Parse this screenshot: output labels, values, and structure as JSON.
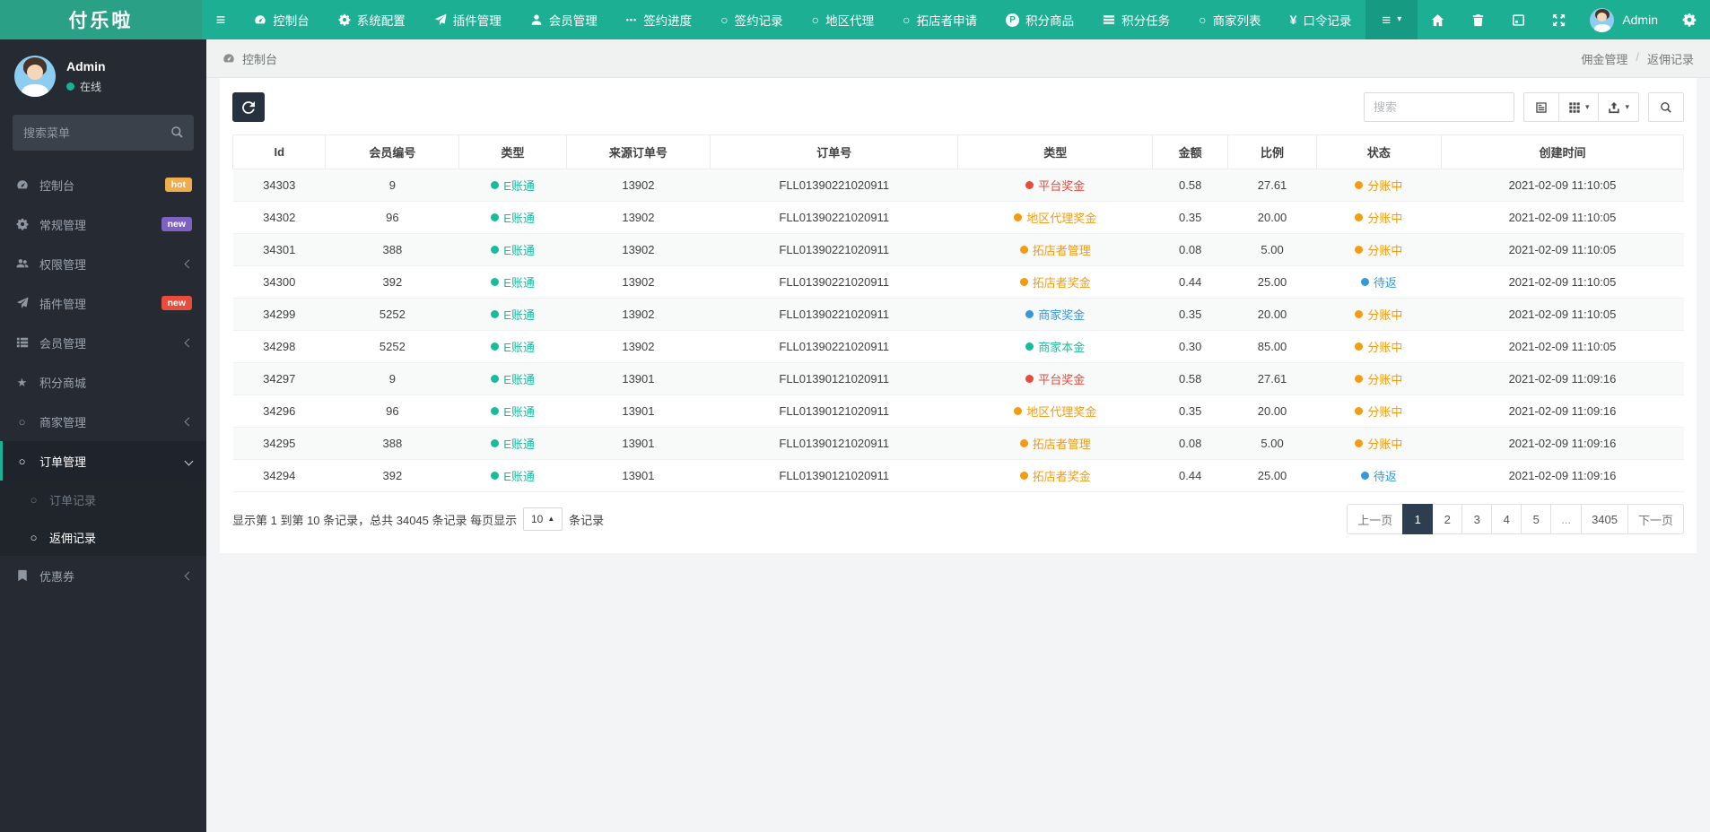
{
  "brand": "付乐啦",
  "navbar": {
    "menu": [
      {
        "key": "dashboard",
        "label": "控制台",
        "icon": "gauge-icon"
      },
      {
        "key": "system-config",
        "label": "系统配置",
        "icon": "gear-icon"
      },
      {
        "key": "plugin-manage",
        "label": "插件管理",
        "icon": "paper-plane-icon"
      },
      {
        "key": "member-manage",
        "label": "会员管理",
        "icon": "user-icon"
      },
      {
        "key": "sign-progress",
        "label": "签约进度",
        "icon": "ellipsis-icon"
      },
      {
        "key": "sign-records",
        "label": "签约记录",
        "icon": "circle-icon"
      },
      {
        "key": "region-agent",
        "label": "地区代理",
        "icon": "circle-icon"
      },
      {
        "key": "shop-applicant",
        "label": "拓店者申请",
        "icon": "circle-icon"
      },
      {
        "key": "points-goods",
        "label": "积分商品",
        "icon": "p-circle-icon"
      },
      {
        "key": "points-task",
        "label": "积分任务",
        "icon": "bars-icon"
      },
      {
        "key": "merchant-list",
        "label": "商家列表",
        "icon": "circle-icon"
      },
      {
        "key": "password-records",
        "label": "口令记录",
        "icon": "yen-icon"
      }
    ],
    "username": "Admin"
  },
  "sidebar": {
    "username": "Admin",
    "status": "在线",
    "search_placeholder": "搜索菜单",
    "menu": [
      {
        "key": "dashboard",
        "label": "控制台",
        "icon": "gauge-icon",
        "badge": "hot",
        "badge_color": "#f0ad4e"
      },
      {
        "key": "general-manage",
        "label": "常规管理",
        "icon": "cogs-icon",
        "badge": "new",
        "badge_color": "#7d62c3"
      },
      {
        "key": "permission-manage",
        "label": "权限管理",
        "icon": "users-icon",
        "chevron": "left"
      },
      {
        "key": "plugin-manage",
        "label": "插件管理",
        "icon": "paper-plane-icon",
        "badge": "new",
        "badge_color": "#e74c3c"
      },
      {
        "key": "member-manage",
        "label": "会员管理",
        "icon": "list-icon",
        "chevron": "left"
      },
      {
        "key": "points-mall",
        "label": "积分商城",
        "icon": "star-icon"
      },
      {
        "key": "merchant-manage",
        "label": "商家管理",
        "icon": "circle-icon",
        "chevron": "left"
      },
      {
        "key": "order-manage",
        "label": "订单管理",
        "icon": "circle-icon",
        "chevron": "down",
        "active": true
      },
      {
        "key": "order-records",
        "label": "订单记录",
        "icon": "circle-icon",
        "sub": true
      },
      {
        "key": "rebate-records",
        "label": "返佣记录",
        "icon": "circle-icon",
        "sub": true,
        "active": true
      },
      {
        "key": "coupon",
        "label": "优惠券",
        "icon": "bookmark-icon",
        "chevron": "left"
      }
    ]
  },
  "breadcrumb": {
    "left": "控制台",
    "right_parent": "佣金管理",
    "divider": "/",
    "right_current": "返佣记录"
  },
  "toolbar": {
    "search_placeholder": "搜索"
  },
  "table": {
    "headers": [
      "Id",
      "会员编号",
      "类型",
      "来源订单号",
      "订单号",
      "类型",
      "金额",
      "比例",
      "状态",
      "创建时间"
    ],
    "rows": [
      {
        "id": "34303",
        "member": "9",
        "type1": "E账通",
        "type1_color": "#18bc9c",
        "source": "13902",
        "order": "FLL01390221020911",
        "type2": "平台奖金",
        "type2_color": "#e74c3c",
        "amount": "0.58",
        "ratio": "27.61",
        "status": "分账中",
        "status_color": "#f39c12",
        "created": "2021-02-09 11:10:05"
      },
      {
        "id": "34302",
        "member": "96",
        "type1": "E账通",
        "type1_color": "#18bc9c",
        "source": "13902",
        "order": "FLL01390221020911",
        "type2": "地区代理奖金",
        "type2_color": "#f39c12",
        "amount": "0.35",
        "ratio": "20.00",
        "status": "分账中",
        "status_color": "#f39c12",
        "created": "2021-02-09 11:10:05"
      },
      {
        "id": "34301",
        "member": "388",
        "type1": "E账通",
        "type1_color": "#18bc9c",
        "source": "13902",
        "order": "FLL01390221020911",
        "type2": "拓店者管理",
        "type2_color": "#f39c12",
        "amount": "0.08",
        "ratio": "5.00",
        "status": "分账中",
        "status_color": "#f39c12",
        "created": "2021-02-09 11:10:05"
      },
      {
        "id": "34300",
        "member": "392",
        "type1": "E账通",
        "type1_color": "#18bc9c",
        "source": "13902",
        "order": "FLL01390221020911",
        "type2": "拓店者奖金",
        "type2_color": "#f39c12",
        "amount": "0.44",
        "ratio": "25.00",
        "status": "待返",
        "status_color": "#3498db",
        "created": "2021-02-09 11:10:05"
      },
      {
        "id": "34299",
        "member": "5252",
        "type1": "E账通",
        "type1_color": "#18bc9c",
        "source": "13902",
        "order": "FLL01390221020911",
        "type2": "商家奖金",
        "type2_color": "#3498db",
        "amount": "0.35",
        "ratio": "20.00",
        "status": "分账中",
        "status_color": "#f39c12",
        "created": "2021-02-09 11:10:05"
      },
      {
        "id": "34298",
        "member": "5252",
        "type1": "E账通",
        "type1_color": "#18bc9c",
        "source": "13902",
        "order": "FLL01390221020911",
        "type2": "商家本金",
        "type2_color": "#18bc9c",
        "amount": "0.30",
        "ratio": "85.00",
        "status": "分账中",
        "status_color": "#f39c12",
        "created": "2021-02-09 11:10:05"
      },
      {
        "id": "34297",
        "member": "9",
        "type1": "E账通",
        "type1_color": "#18bc9c",
        "source": "13901",
        "order": "FLL01390121020911",
        "type2": "平台奖金",
        "type2_color": "#e74c3c",
        "amount": "0.58",
        "ratio": "27.61",
        "status": "分账中",
        "status_color": "#f39c12",
        "created": "2021-02-09 11:09:16"
      },
      {
        "id": "34296",
        "member": "96",
        "type1": "E账通",
        "type1_color": "#18bc9c",
        "source": "13901",
        "order": "FLL01390121020911",
        "type2": "地区代理奖金",
        "type2_color": "#f39c12",
        "amount": "0.35",
        "ratio": "20.00",
        "status": "分账中",
        "status_color": "#f39c12",
        "created": "2021-02-09 11:09:16"
      },
      {
        "id": "34295",
        "member": "388",
        "type1": "E账通",
        "type1_color": "#18bc9c",
        "source": "13901",
        "order": "FLL01390121020911",
        "type2": "拓店者管理",
        "type2_color": "#f39c12",
        "amount": "0.08",
        "ratio": "5.00",
        "status": "分账中",
        "status_color": "#f39c12",
        "created": "2021-02-09 11:09:16"
      },
      {
        "id": "34294",
        "member": "392",
        "type1": "E账通",
        "type1_color": "#18bc9c",
        "source": "13901",
        "order": "FLL01390121020911",
        "type2": "拓店者奖金",
        "type2_color": "#f39c12",
        "amount": "0.44",
        "ratio": "25.00",
        "status": "待返",
        "status_color": "#3498db",
        "created": "2021-02-09 11:09:16"
      }
    ]
  },
  "footer": {
    "summary_prefix": "显示第 1 到第 10 条记录，总共 34045 条记录 每页显示",
    "page_size": "10",
    "summary_suffix": "条记录",
    "pagination": [
      {
        "key": "prev",
        "label": "上一页"
      },
      {
        "key": "1",
        "label": "1",
        "active": true
      },
      {
        "key": "2",
        "label": "2"
      },
      {
        "key": "3",
        "label": "3"
      },
      {
        "key": "4",
        "label": "4"
      },
      {
        "key": "5",
        "label": "5"
      },
      {
        "key": "ellipsis",
        "label": "...",
        "disabled": true
      },
      {
        "key": "3405",
        "label": "3405"
      },
      {
        "key": "next",
        "label": "下一页"
      }
    ]
  },
  "colors": {
    "navbar_green": "#1daf94",
    "brand_green": "#2aa187",
    "sidebar_dark": "#262b33",
    "accent_green": "#18bc9c",
    "primary_dark": "#2c3e50",
    "status_red": "#e74c3c",
    "status_orange": "#f39c12",
    "status_blue": "#3498db",
    "badge_hot": "#f0ad4e",
    "badge_new_purple": "#7d62c3",
    "badge_new_red": "#e74c3c"
  }
}
